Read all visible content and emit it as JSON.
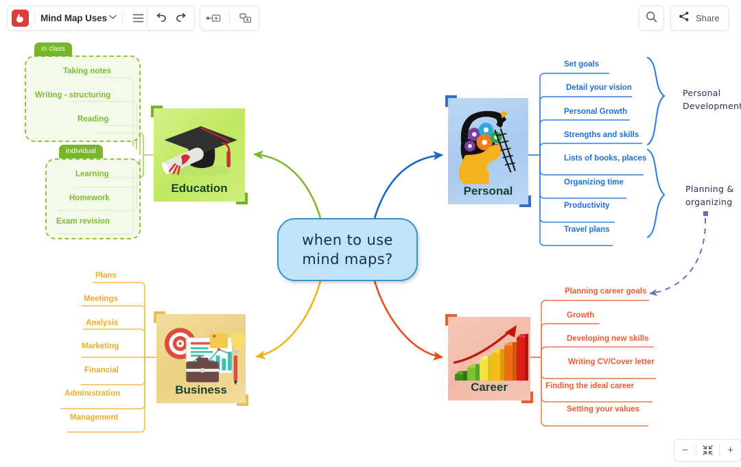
{
  "app": {
    "logo_icon": "app-logo-icon",
    "doc_title": "Mind Map Uses",
    "chevron_icon": "chevron-down-icon",
    "menu_icon": "hamburger-menu-icon",
    "undo_icon": "undo-arrow-icon",
    "redo_icon": "redo-arrow-icon",
    "insert_topic_icon": "insert-sibling-topic-icon",
    "insert_subtopic_icon": "insert-subtopic-icon",
    "search_icon": "search-icon",
    "share_icon": "share-icon",
    "share_label": "Share"
  },
  "zoom_controls": {
    "zoom_out_icon": "minus-icon",
    "fit_screen_icon": "fit-to-screen-icon",
    "zoom_in_icon": "plus-icon",
    "zoom_out_label": "−",
    "zoom_in_label": "+"
  },
  "center": {
    "line1": "when to use",
    "line2": "mind maps?"
  },
  "branches": {
    "education": {
      "label": "Education",
      "color": "#8cc63f",
      "image_icon": "graduation-cap-diploma-icon",
      "groups": [
        {
          "tab": "in class",
          "items": [
            "Taking notes",
            "Writing - structuring",
            "Reading"
          ]
        },
        {
          "tab": "individual",
          "items": [
            "Learning",
            "Homework",
            "Exam revision"
          ]
        }
      ]
    },
    "personal": {
      "label": "Personal",
      "color": "#1e6fd9",
      "image_icon": "head-with-gears-icon",
      "items": [
        "Set goals",
        "Detail your vision",
        "Personal Growth",
        "Strengths and skills",
        "Lists of books, places",
        "Organizing time",
        "Productivity",
        "Travel plans"
      ],
      "summaries": [
        {
          "line1": "Personal",
          "line2": "Development"
        },
        {
          "line1": "Planning &",
          "line2": "organizing"
        }
      ]
    },
    "business": {
      "label": "Business",
      "color": "#f0ab26",
      "image_icon": "business-target-chart-briefcase-icon",
      "items": [
        "Plans",
        "Meetings",
        "Analysis",
        "Marketing",
        "Financial",
        "Administration",
        "Management"
      ]
    },
    "career": {
      "label": "Career",
      "color": "#f05a33",
      "image_icon": "growth-bar-chart-arrow-icon",
      "items": [
        "Planning career goals",
        "Growth",
        "Developing new skills",
        "Writing CV/Cover letter",
        "Finding the ideal career",
        "Setting  your values"
      ]
    }
  },
  "relationship": {
    "from": "Planning & organizing",
    "to": "Planning career goals",
    "style": "dashed-arrow"
  }
}
